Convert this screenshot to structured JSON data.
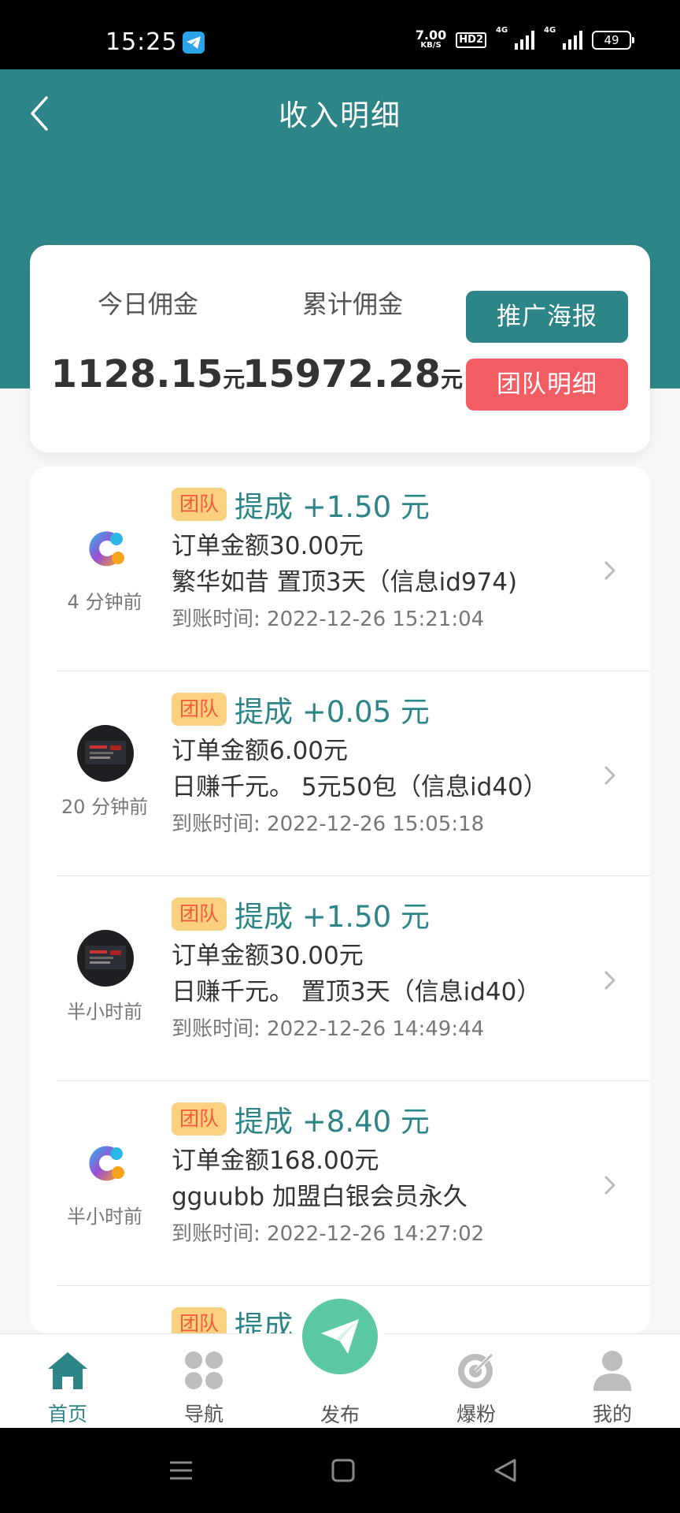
{
  "status_bar": {
    "time": "15:25",
    "net_speed_value": "7.00",
    "net_speed_unit": "KB/S",
    "hd_badge": "HD2",
    "signal1_label": "4G",
    "signal2_label": "4G",
    "battery": "49"
  },
  "header": {
    "title": "收入明细"
  },
  "summary": {
    "today_label": "今日佣金",
    "today_value": "1128.15",
    "total_label": "累计佣金",
    "total_value": "15972.28",
    "unit": "元",
    "poster_button": "推广海报",
    "team_button": "团队明细"
  },
  "records": [
    {
      "time_ago": "4 分钟前",
      "avatar": "logo",
      "tag": "团队",
      "commission": "提成 +1.50 元",
      "order_amount": "订单金额30.00元",
      "desc": "繁华如昔 置顶3天（信息id974)",
      "arrival_time": "到账时间: 2022-12-26 15:21:04"
    },
    {
      "time_ago": "20 分钟前",
      "avatar": "dark",
      "tag": "团队",
      "commission": "提成 +0.05 元",
      "order_amount": "订单金额6.00元",
      "desc": "日赚千元。 5元50包（信息id40）",
      "arrival_time": "到账时间: 2022-12-26 15:05:18"
    },
    {
      "time_ago": "半小时前",
      "avatar": "dark",
      "tag": "团队",
      "commission": "提成 +1.50 元",
      "order_amount": "订单金额30.00元",
      "desc": "日赚千元。 置顶3天（信息id40）",
      "arrival_time": "到账时间: 2022-12-26 14:49:44"
    },
    {
      "time_ago": "半小时前",
      "avatar": "logo",
      "tag": "团队",
      "commission": "提成 +8.40 元",
      "order_amount": "订单金额168.00元",
      "desc": "gguubb 加盟白银会员永久",
      "arrival_time": "到账时间: 2022-12-26 14:27:02"
    },
    {
      "time_ago": "",
      "avatar": "logo",
      "tag": "团队",
      "commission": "提成",
      "order_amount": "",
      "desc": "",
      "arrival_time": ""
    }
  ],
  "bottom_nav": {
    "home": "首页",
    "navigation": "导航",
    "publish": "发布",
    "boost": "爆粉",
    "mine": "我的"
  },
  "colors": {
    "primary": "#2e8587",
    "danger": "#f25d64",
    "tag_bg": "#fbd07e",
    "tag_text": "#f05a3d",
    "publish": "#5cc9a4"
  }
}
